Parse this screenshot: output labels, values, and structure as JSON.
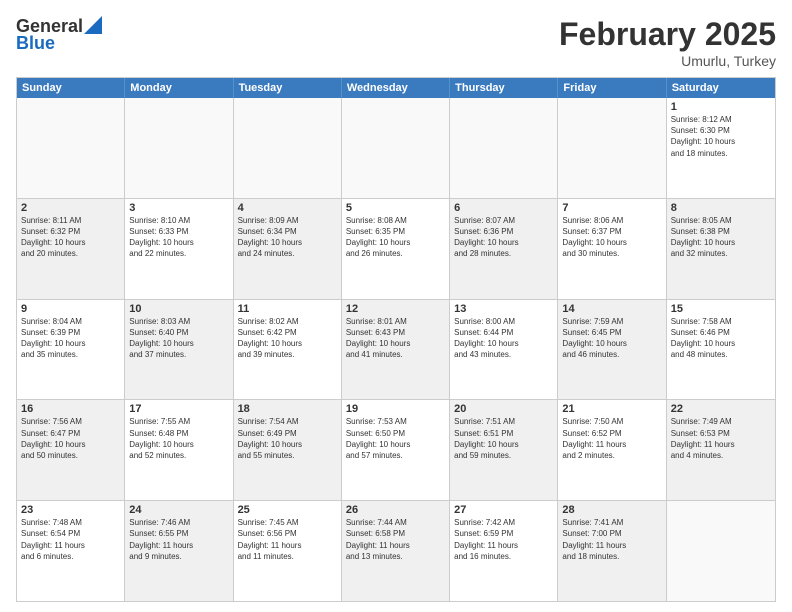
{
  "header": {
    "logo_general": "General",
    "logo_blue": "Blue",
    "main_title": "February 2025",
    "subtitle": "Umurlu, Turkey"
  },
  "calendar": {
    "days": [
      "Sunday",
      "Monday",
      "Tuesday",
      "Wednesday",
      "Thursday",
      "Friday",
      "Saturday"
    ],
    "rows": [
      [
        {
          "day": "",
          "info": "",
          "empty": true
        },
        {
          "day": "",
          "info": "",
          "empty": true
        },
        {
          "day": "",
          "info": "",
          "empty": true
        },
        {
          "day": "",
          "info": "",
          "empty": true
        },
        {
          "day": "",
          "info": "",
          "empty": true
        },
        {
          "day": "",
          "info": "",
          "empty": true
        },
        {
          "day": "1",
          "info": "Sunrise: 8:12 AM\nSunset: 6:30 PM\nDaylight: 10 hours\nand 18 minutes.",
          "empty": false
        }
      ],
      [
        {
          "day": "2",
          "info": "Sunrise: 8:11 AM\nSunset: 6:32 PM\nDaylight: 10 hours\nand 20 minutes.",
          "shaded": true
        },
        {
          "day": "3",
          "info": "Sunrise: 8:10 AM\nSunset: 6:33 PM\nDaylight: 10 hours\nand 22 minutes.",
          "shaded": false
        },
        {
          "day": "4",
          "info": "Sunrise: 8:09 AM\nSunset: 6:34 PM\nDaylight: 10 hours\nand 24 minutes.",
          "shaded": true
        },
        {
          "day": "5",
          "info": "Sunrise: 8:08 AM\nSunset: 6:35 PM\nDaylight: 10 hours\nand 26 minutes.",
          "shaded": false
        },
        {
          "day": "6",
          "info": "Sunrise: 8:07 AM\nSunset: 6:36 PM\nDaylight: 10 hours\nand 28 minutes.",
          "shaded": true
        },
        {
          "day": "7",
          "info": "Sunrise: 8:06 AM\nSunset: 6:37 PM\nDaylight: 10 hours\nand 30 minutes.",
          "shaded": false
        },
        {
          "day": "8",
          "info": "Sunrise: 8:05 AM\nSunset: 6:38 PM\nDaylight: 10 hours\nand 32 minutes.",
          "shaded": true
        }
      ],
      [
        {
          "day": "9",
          "info": "Sunrise: 8:04 AM\nSunset: 6:39 PM\nDaylight: 10 hours\nand 35 minutes.",
          "shaded": false
        },
        {
          "day": "10",
          "info": "Sunrise: 8:03 AM\nSunset: 6:40 PM\nDaylight: 10 hours\nand 37 minutes.",
          "shaded": true
        },
        {
          "day": "11",
          "info": "Sunrise: 8:02 AM\nSunset: 6:42 PM\nDaylight: 10 hours\nand 39 minutes.",
          "shaded": false
        },
        {
          "day": "12",
          "info": "Sunrise: 8:01 AM\nSunset: 6:43 PM\nDaylight: 10 hours\nand 41 minutes.",
          "shaded": true
        },
        {
          "day": "13",
          "info": "Sunrise: 8:00 AM\nSunset: 6:44 PM\nDaylight: 10 hours\nand 43 minutes.",
          "shaded": false
        },
        {
          "day": "14",
          "info": "Sunrise: 7:59 AM\nSunset: 6:45 PM\nDaylight: 10 hours\nand 46 minutes.",
          "shaded": true
        },
        {
          "day": "15",
          "info": "Sunrise: 7:58 AM\nSunset: 6:46 PM\nDaylight: 10 hours\nand 48 minutes.",
          "shaded": false
        }
      ],
      [
        {
          "day": "16",
          "info": "Sunrise: 7:56 AM\nSunset: 6:47 PM\nDaylight: 10 hours\nand 50 minutes.",
          "shaded": true
        },
        {
          "day": "17",
          "info": "Sunrise: 7:55 AM\nSunset: 6:48 PM\nDaylight: 10 hours\nand 52 minutes.",
          "shaded": false
        },
        {
          "day": "18",
          "info": "Sunrise: 7:54 AM\nSunset: 6:49 PM\nDaylight: 10 hours\nand 55 minutes.",
          "shaded": true
        },
        {
          "day": "19",
          "info": "Sunrise: 7:53 AM\nSunset: 6:50 PM\nDaylight: 10 hours\nand 57 minutes.",
          "shaded": false
        },
        {
          "day": "20",
          "info": "Sunrise: 7:51 AM\nSunset: 6:51 PM\nDaylight: 10 hours\nand 59 minutes.",
          "shaded": true
        },
        {
          "day": "21",
          "info": "Sunrise: 7:50 AM\nSunset: 6:52 PM\nDaylight: 11 hours\nand 2 minutes.",
          "shaded": false
        },
        {
          "day": "22",
          "info": "Sunrise: 7:49 AM\nSunset: 6:53 PM\nDaylight: 11 hours\nand 4 minutes.",
          "shaded": true
        }
      ],
      [
        {
          "day": "23",
          "info": "Sunrise: 7:48 AM\nSunset: 6:54 PM\nDaylight: 11 hours\nand 6 minutes.",
          "shaded": false
        },
        {
          "day": "24",
          "info": "Sunrise: 7:46 AM\nSunset: 6:55 PM\nDaylight: 11 hours\nand 9 minutes.",
          "shaded": true
        },
        {
          "day": "25",
          "info": "Sunrise: 7:45 AM\nSunset: 6:56 PM\nDaylight: 11 hours\nand 11 minutes.",
          "shaded": false
        },
        {
          "day": "26",
          "info": "Sunrise: 7:44 AM\nSunset: 6:58 PM\nDaylight: 11 hours\nand 13 minutes.",
          "shaded": true
        },
        {
          "day": "27",
          "info": "Sunrise: 7:42 AM\nSunset: 6:59 PM\nDaylight: 11 hours\nand 16 minutes.",
          "shaded": false
        },
        {
          "day": "28",
          "info": "Sunrise: 7:41 AM\nSunset: 7:00 PM\nDaylight: 11 hours\nand 18 minutes.",
          "shaded": true
        },
        {
          "day": "",
          "info": "",
          "empty": true
        }
      ]
    ]
  }
}
